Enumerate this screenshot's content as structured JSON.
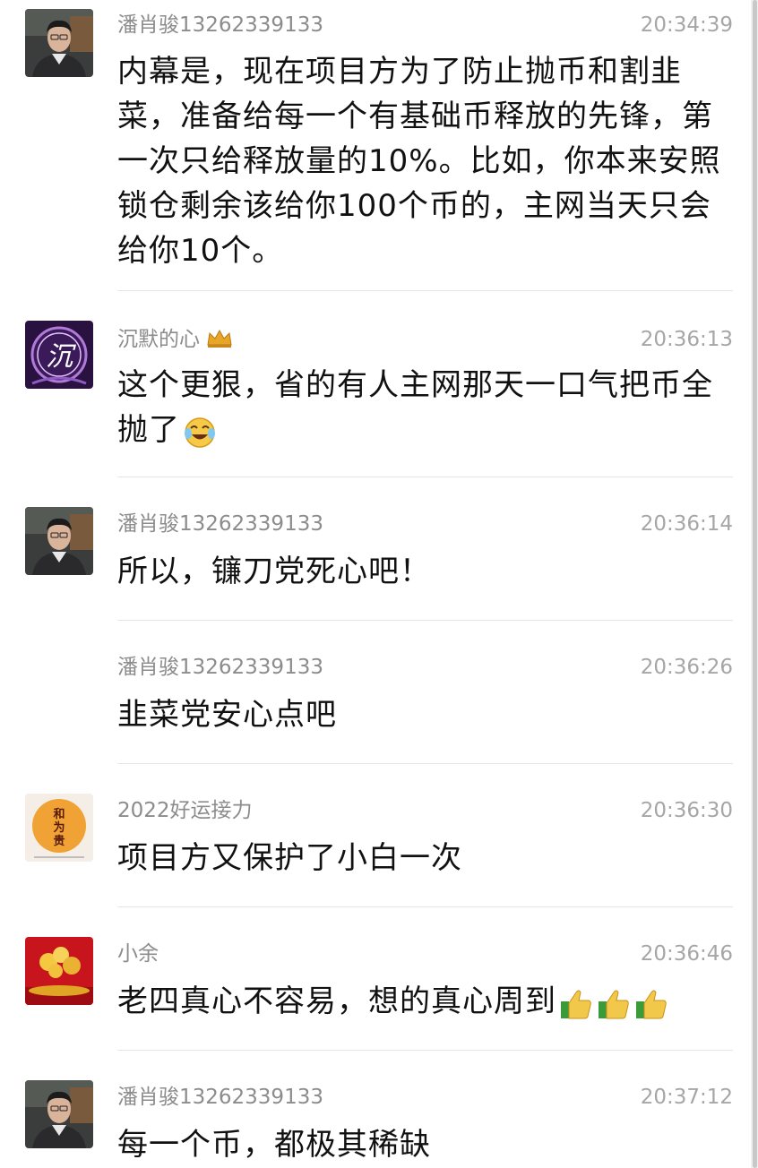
{
  "messages": [
    {
      "sender": "潘肖骏13262339133",
      "time": "20:34:39",
      "text": "内幕是，现在项目方为了防止抛币和割韭菜，准备给每一个有基础币释放的先锋，第一次只给释放量的10%。比如，你本来安照锁仓剩余该给你100个币的，主网当天只会给你10个。",
      "avatar": "man-portrait-avatar"
    },
    {
      "sender": "沉默的心",
      "sender_icon": "crown-icon",
      "time": "20:36:13",
      "text": "这个更狠，省的有人主网那天一口气把币全抛了",
      "emoji": "laughing-crying-emoji-icon",
      "avatar": "purple-logo-avatar"
    },
    {
      "sender": "潘肖骏13262339133",
      "time": "20:36:14",
      "text": "所以，镰刀党死心吧！",
      "avatar": "man-portrait-avatar"
    },
    {
      "sender": "潘肖骏13262339133",
      "time": "20:36:26",
      "text": "韭菜党安心点吧"
    },
    {
      "sender": "2022好运接力",
      "time": "20:36:30",
      "text": "项目方又保护了小白一次",
      "avatar": "orange-seal-avatar",
      "avatar_text": "和为贵"
    },
    {
      "sender": "小余",
      "time": "20:36:46",
      "text": "老四真心不容易，想的真心周到",
      "emoji": "thumbs-up-icon",
      "emoji_count": 3,
      "avatar": "red-gold-avatar"
    },
    {
      "sender": "潘肖骏13262339133",
      "time": "20:37:12",
      "text": "每一个币，都极其稀缺",
      "avatar": "man-portrait-avatar"
    }
  ],
  "colors": {
    "sender": "#8c8c8c",
    "time": "#a6a6a6",
    "text": "#111111",
    "separator": "#e6e6e6"
  }
}
